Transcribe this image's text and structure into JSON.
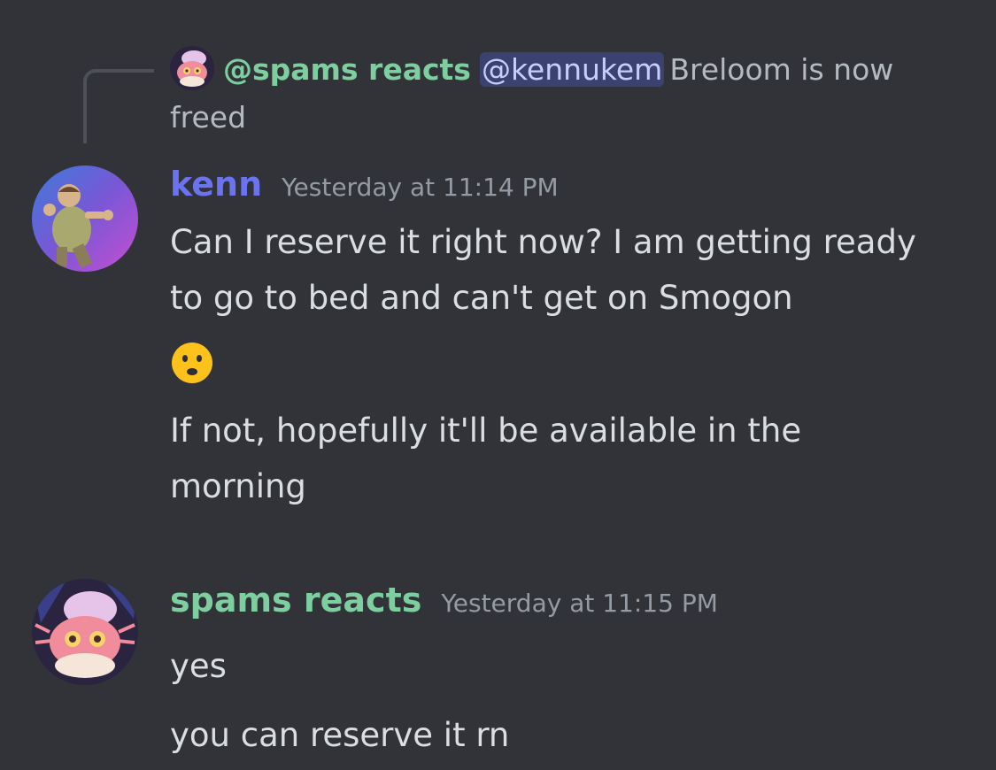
{
  "reply": {
    "author": "@spams reacts",
    "mention": "@kennukem",
    "text": "Breloom is now freed"
  },
  "messages": [
    {
      "author": "kenn",
      "timestamp": "Yesterday at 11:14 PM",
      "lines": [
        "Can I reserve it right now? I am getting ready to go to bed and can't get on Smogon",
        "If not, hopefully it'll be available in the morning"
      ],
      "emoji": "frowning-face-emoji"
    },
    {
      "author": "spams reacts",
      "timestamp": "Yesterday at 11:15 PM",
      "lines": [
        "yes",
        "you can reserve it rn"
      ]
    }
  ],
  "colors": {
    "background": "#313338",
    "kenn_name": "#6b73f0",
    "spams_name": "#7ecfa0",
    "text": "#dbdee1",
    "muted": "#949ba4",
    "mention_bg": "#3c4270"
  }
}
